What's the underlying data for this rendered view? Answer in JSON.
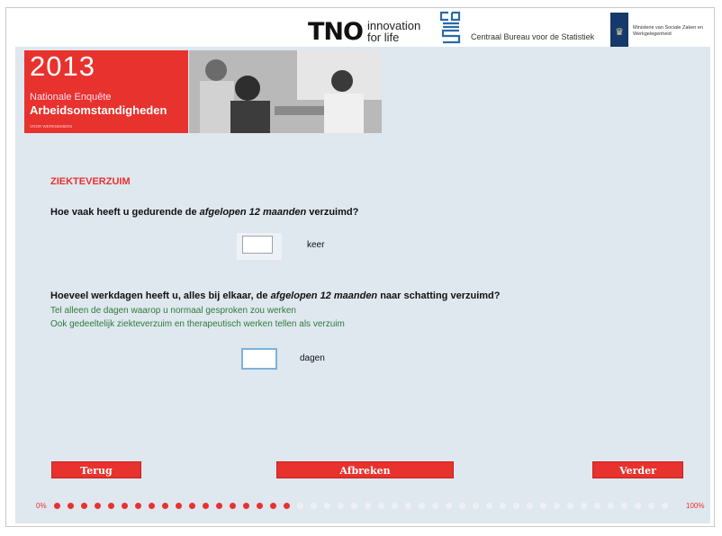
{
  "header": {
    "tno_mark": "TNO",
    "tno_tagline_1": "innovation",
    "tno_tagline_2": "for life",
    "cbs_name": "Centraal Bureau voor de Statistiek",
    "ministry_name": "Ministerie van Sociale Zaken en Werkgelegenheid"
  },
  "banner": {
    "year": "2013",
    "line1": "Nationale Enquête",
    "line2": "Arbeidsomstandigheden",
    "line3": "VOOR WERKNEMERS"
  },
  "form": {
    "section_title": "ZIEKTEVERZUIM",
    "q1": {
      "prefix": "Hoe vaak heeft u gedurende de ",
      "emph": "afgelopen 12 maanden",
      "suffix": " verzuimd?",
      "value": "",
      "unit": "keer"
    },
    "q2": {
      "prefix": "Hoeveel werkdagen heeft u, alles bij elkaar, de ",
      "emph": "afgelopen 12 maanden",
      "suffix": " naar schatting verzuimd?",
      "hint1": "Tel alleen de dagen waarop u normaal gesproken zou werken",
      "hint2": "Ook gedeeltelijk ziekteverzuim en therapeutisch werken tellen als verzuim",
      "value": "",
      "unit": "dagen"
    }
  },
  "buttons": {
    "back": "Terug",
    "abort": "Afbreken",
    "next": "Verder"
  },
  "progress": {
    "start_label": "0%",
    "end_label": "100%",
    "completed": 0.4,
    "color_done": "#e8322e",
    "color_todo": "#eef1f4"
  }
}
